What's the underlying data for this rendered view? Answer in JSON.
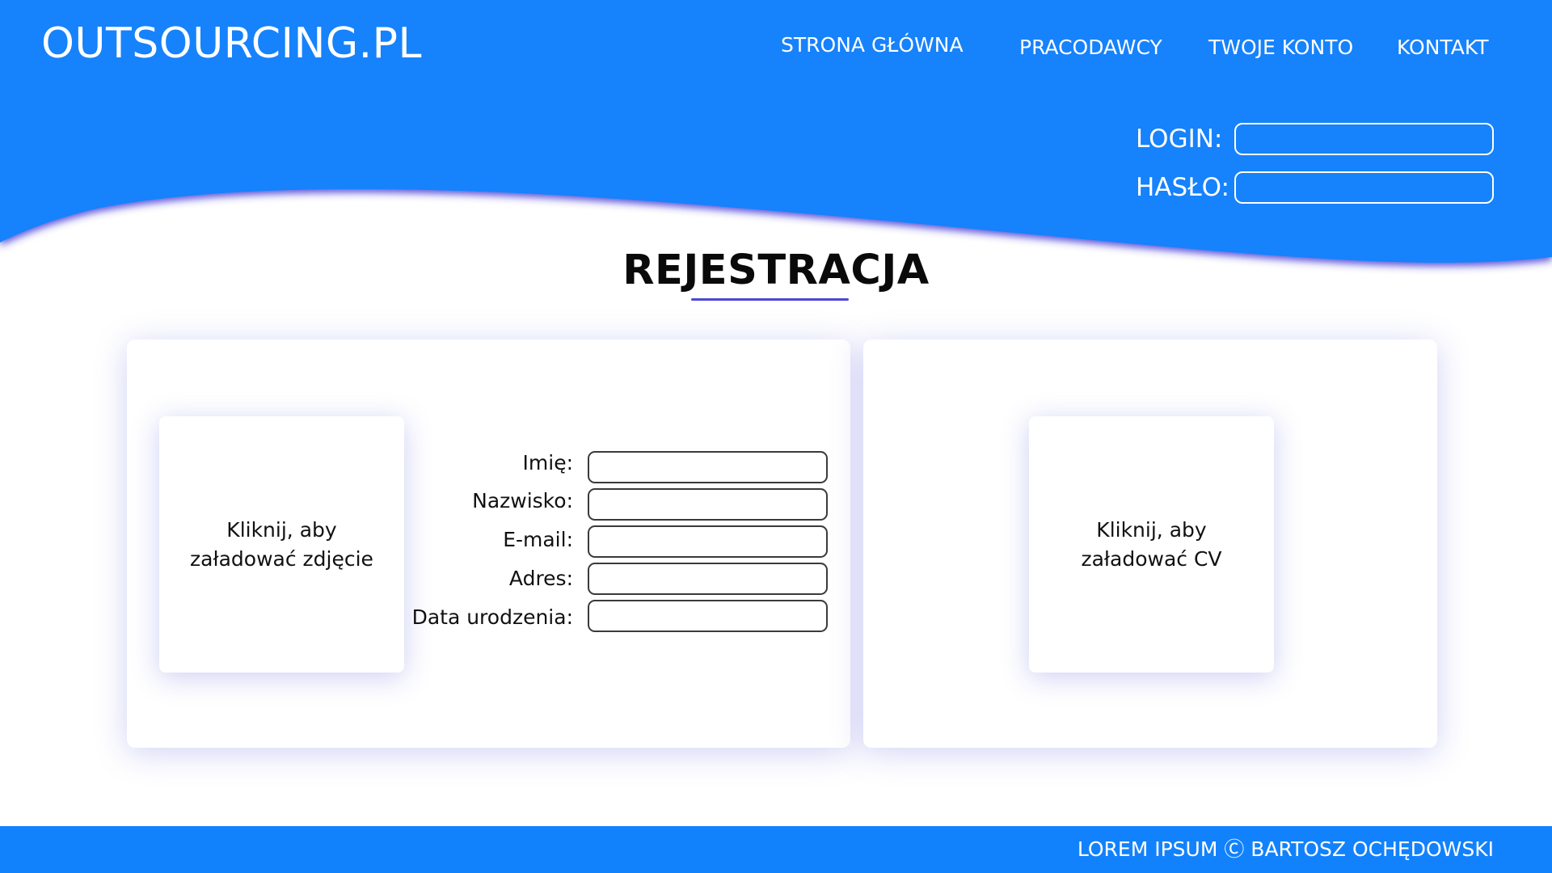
{
  "colors": {
    "brand": "#1282fc",
    "accent": "#4b49d4",
    "shadow": "#c9ccf5"
  },
  "header": {
    "logo": "OUTSOURCING.PL",
    "nav": [
      "STRONA GŁÓWNA",
      "PRACODAWCY",
      "TWOJE KONTO",
      "KONTAKT"
    ],
    "login_label": "LOGIN:",
    "login_value": "",
    "password_label": "HASŁO:",
    "password_value": ""
  },
  "main": {
    "title": "REJESTRACJA",
    "photo_upload": "Kliknij, aby załadować zdjęcie",
    "cv_upload": "Kliknij, aby załadować CV",
    "fields": [
      {
        "label": "Imię:",
        "value": ""
      },
      {
        "label": "Nazwisko:",
        "value": ""
      },
      {
        "label": "E-mail:",
        "value": ""
      },
      {
        "label": "Adres:",
        "value": ""
      },
      {
        "label": "Data urodzenia:",
        "value": ""
      }
    ]
  },
  "footer": {
    "text": "LOREM IPSUM Ⓒ BARTOSZ OCHĘDOWSKI"
  }
}
